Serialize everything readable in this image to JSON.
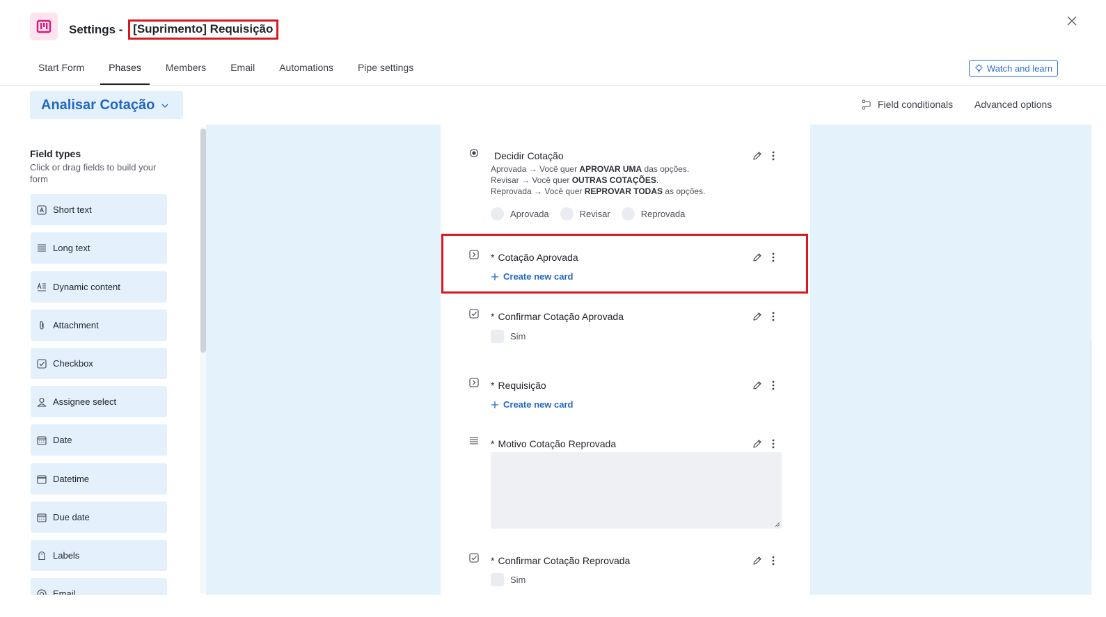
{
  "header": {
    "title_prefix": "Settings - ",
    "title_highlight": "[Suprimento] Requisição"
  },
  "tabs": [
    {
      "label": "Start Form"
    },
    {
      "label": "Phases",
      "active": true
    },
    {
      "label": "Members"
    },
    {
      "label": "Email"
    },
    {
      "label": "Automations"
    },
    {
      "label": "Pipe settings"
    }
  ],
  "watch_button": {
    "label": "Watch and learn",
    "icon": "lightbulb-icon"
  },
  "phase": {
    "current": "Analisar Cotação"
  },
  "toolbar": {
    "field_conditionals": "Field conditionals",
    "advanced_options": "Advanced options"
  },
  "sidebar": {
    "title": "Field types",
    "subtitle": "Click or drag fields to build your form",
    "items": [
      {
        "label": "Short text",
        "icon": "short-text-icon"
      },
      {
        "label": "Long text",
        "icon": "long-text-icon"
      },
      {
        "label": "Dynamic content",
        "icon": "dynamic-content-icon"
      },
      {
        "label": "Attachment",
        "icon": "paperclip-icon"
      },
      {
        "label": "Checkbox",
        "icon": "checkbox-icon"
      },
      {
        "label": "Assignee select",
        "icon": "user-icon"
      },
      {
        "label": "Date",
        "icon": "calendar-icon"
      },
      {
        "label": "Datetime",
        "icon": "datetime-icon"
      },
      {
        "label": "Due date",
        "icon": "due-date-icon"
      },
      {
        "label": "Labels",
        "icon": "tag-icon"
      },
      {
        "label": "Email",
        "icon": "at-icon"
      }
    ]
  },
  "fields": {
    "decidir": {
      "label": "Decidir Cotação",
      "desc": [
        {
          "a": "Aprovada → Você quer ",
          "b": "APROVAR UMA",
          "c": " das opções."
        },
        {
          "a": "Revisar → Você quer ",
          "b": "OUTRAS COTAÇÕES",
          "c": "."
        },
        {
          "a": "Reprovada → Você quer ",
          "b": "REPROVAR TODAS",
          "c": " as opções."
        }
      ],
      "options": [
        "Aprovada",
        "Revisar",
        "Reprovada"
      ]
    },
    "cotacao_aprovada": {
      "required": "*",
      "label": "Cotação Aprovada",
      "action": "Create new card"
    },
    "confirmar_aprovada": {
      "required": "*",
      "label": "Confirmar Cotação Aprovada",
      "option": "Sim"
    },
    "requisicao": {
      "required": "*",
      "label": "Requisição",
      "action": "Create new card"
    },
    "motivo": {
      "required": "*",
      "label": "Motivo Cotação Reprovada"
    },
    "confirmar_reprovada": {
      "required": "*",
      "label": "Confirmar Cotação Reprovada",
      "option": "Sim"
    }
  },
  "colors": {
    "accent": "#2466c5",
    "highlight": "#d7191f",
    "canvas": "#e4f2fc",
    "logo_bg": "#fde4ee",
    "logo_fg": "#e0177a"
  }
}
